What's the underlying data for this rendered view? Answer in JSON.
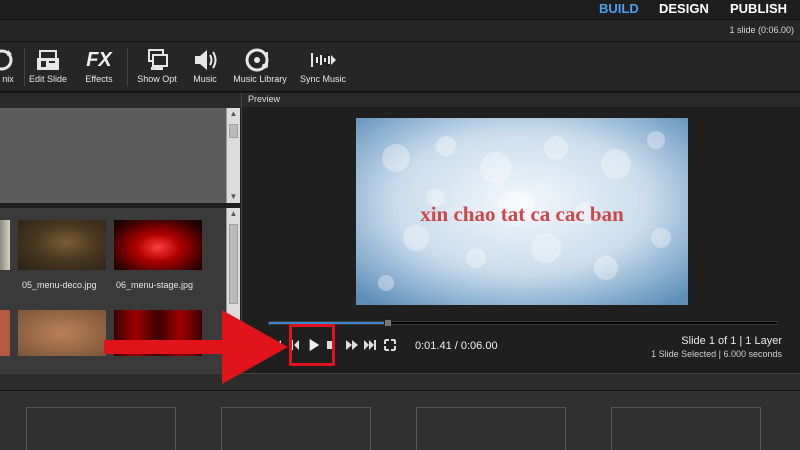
{
  "topnav": [
    {
      "label": "BUILD",
      "active": true
    },
    {
      "label": "DESIGN",
      "active": false
    },
    {
      "label": "PUBLISH",
      "active": false
    }
  ],
  "info": {
    "slide_count": "1 slide (0:06.00)"
  },
  "toolbar": {
    "items": [
      {
        "label": "nix",
        "icon": "remix-icon"
      },
      {
        "label": "Edit Slide",
        "icon": "edit-slide-icon"
      },
      {
        "label": "Effects",
        "icon": "fx-icon",
        "icon_text": "FX"
      },
      {
        "label": "Show Opt",
        "icon": "show-options-icon"
      },
      {
        "label": "Music",
        "icon": "speaker-icon"
      },
      {
        "label": "Music Library",
        "icon": "music-library-icon"
      },
      {
        "label": "Sync Music",
        "icon": "sync-music-icon"
      }
    ]
  },
  "assets": [
    {
      "label": "05_menu-deco.jpg",
      "icon": "texture-thumbnail"
    },
    {
      "label": "06_menu-stage.jpg",
      "icon": "curtain-thumbnail"
    }
  ],
  "preview": {
    "title": "Preview",
    "slide_text": "xin chao tat ca cac ban",
    "text_color": "#d0454a",
    "progress": 0.235,
    "time": "0:01.41 / 0:06.00",
    "slide_position": "Slide 1 of 1  |  1 Layer",
    "selection": "1 Slide Selected  |  6.000 seconds"
  },
  "colors": {
    "accent": "#4a9ff0",
    "annotation": "#e0141a"
  }
}
